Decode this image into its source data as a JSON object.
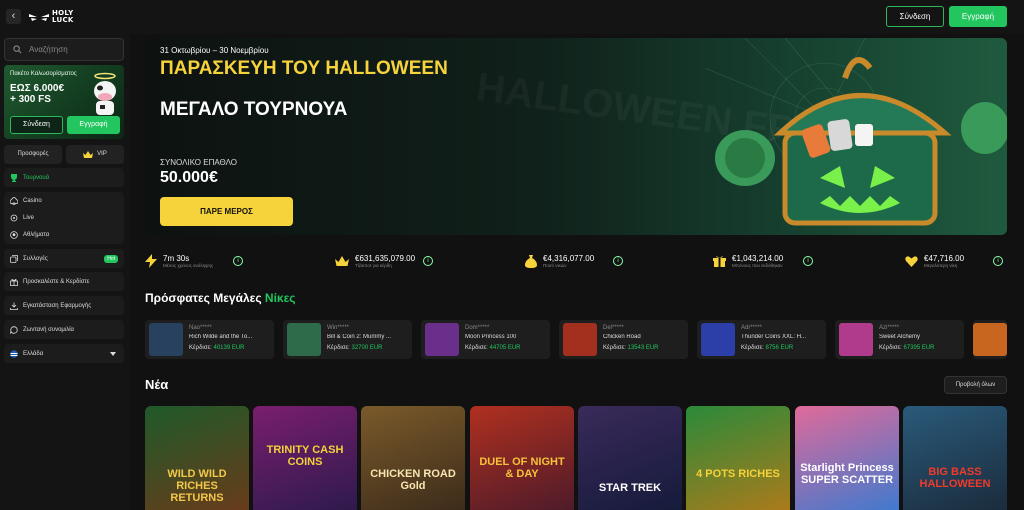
{
  "header": {
    "back_glyph": "‹",
    "logo_line1": "HOLY",
    "logo_line2": "LUCK",
    "login_label": "Σύνδεση",
    "register_label": "Εγγραφή"
  },
  "sidebar": {
    "search_placeholder": "Αναζήτηση",
    "promo": {
      "title": "Πακέτο Καλωσορίσματος",
      "amount_line1": "ΕΩΣ 6.000€",
      "amount_line2": "+ 300 FS",
      "login_label": "Σύνδεση",
      "register_label": "Εγγραφή"
    },
    "offers_label": "Προσφορές",
    "vip_label": "VIP",
    "tournaments_label": "Τουρνουά",
    "group": [
      {
        "label": "Casino",
        "icon": "spade-icon"
      },
      {
        "label": "Live",
        "icon": "live-icon"
      },
      {
        "label": "Αθλήματα",
        "icon": "ball-icon"
      }
    ],
    "collections_label": "Συλλογές",
    "hot_badge": "Hot",
    "invite_label": "Προσκαλέστε & Κερδίστε",
    "install_label": "Εγκατάσταση Εφαρμογής",
    "chat_label": "Ζωντανή συνομιλία",
    "language_label": "Ελλάδα"
  },
  "hero": {
    "date": "31 Οκτωβρίου – 30 Νοεμβρίου",
    "title": "ΠΑΡΑΣΚΕΥΗ ΤΟΥ HALLOWEEN",
    "subtitle": "ΜΕΓΑΛΟ ΤΟΥΡΝΟΥΑ",
    "prize_label": "ΣΥΝΟΛΙΚΟ ΕΠΑΘΛΟ",
    "prize_value": "50.000€",
    "cta_label": "ΠΑΡΕ ΜΕΡΟΣ",
    "watermark": "HALLOWEEN FRI"
  },
  "stats": [
    {
      "value": "7m 30s",
      "label": "Μέσος χρόνος ανάληψης",
      "icon": "lightning-icon"
    },
    {
      "value": "€631,635,079.00",
      "label": "Τζάκποτ για κέρδη",
      "icon": "crown-icon"
    },
    {
      "value": "€4,316,077.00",
      "label": "Ποσό νικών",
      "icon": "moneybag-icon"
    },
    {
      "value": "€1,043,214.00",
      "label": "Μπόνους που εκδόθηκαν",
      "icon": "gift-icon"
    },
    {
      "value": "€47,716.00",
      "label": "Μεγαλύτερη νίκη",
      "icon": "sparkle-heart-icon"
    }
  ],
  "big_wins": {
    "title_part1": "Πρόσφατες Μεγάλες",
    "title_part2": "Νίκες",
    "win_label": "Κέρδισε:",
    "items": [
      {
        "user": "Nao*****",
        "game": "Rich Wilde and the To...",
        "amount": "40139 EUR",
        "color": "#27415e"
      },
      {
        "user": "Win*****",
        "game": "Bill & Coin 2: Mummy ...",
        "amount": "32700 EUR",
        "color": "#2e6b4a"
      },
      {
        "user": "Dom*****",
        "game": "Moon Princess 100",
        "amount": "44705 EUR",
        "color": "#6a2f8a"
      },
      {
        "user": "Del*****",
        "game": "Chicken Road",
        "amount": "13543 EUR",
        "color": "#a3301f"
      },
      {
        "user": "Adr*****",
        "game": "Thunder Coins XXL: H...",
        "amount": "8756 EUR",
        "color": "#2c3fa8"
      },
      {
        "user": "Azi*****",
        "game": "Sweet Alchemy",
        "amount": "67395 EUR",
        "color": "#b03a8c"
      }
    ]
  },
  "new_section": {
    "title": "Νέα",
    "see_all_label": "Προβολή όλων",
    "games": [
      {
        "name": "WILD WILD RICHES RETURNS",
        "bg1": "#1f5a2a",
        "bg2": "#6b3a1a",
        "text_color": "#f2c84b"
      },
      {
        "name": "TRINITY CASH COINS",
        "bg1": "#7a1e6e",
        "bg2": "#2a1a4a",
        "text_color": "#f2d23a"
      },
      {
        "name": "CHICKEN ROAD Gold",
        "bg1": "#7a5a2a",
        "bg2": "#3a2a1a",
        "text_color": "#f6e6b0"
      },
      {
        "name": "DUEL OF NIGHT & DAY",
        "bg1": "#b0301f",
        "bg2": "#4a1a2a",
        "text_color": "#f6c23a"
      },
      {
        "name": "STAR TREK",
        "bg1": "#3a2a5a",
        "bg2": "#141a3a",
        "text_color": "#ffffff"
      },
      {
        "name": "4 POTS RICHES",
        "bg1": "#2a8a3a",
        "bg2": "#b07a1a",
        "text_color": "#f6d23a"
      },
      {
        "name": "Starlight Princess SUPER SCATTER",
        "bg1": "#e06a9a",
        "bg2": "#3a7ad0",
        "text_color": "#ffffff"
      },
      {
        "name": "BIG BASS HALLOWEEN",
        "bg1": "#2a5a7a",
        "bg2": "#1a2a3a",
        "text_color": "#f23a2a"
      }
    ]
  },
  "colors": {
    "accent_green": "#22c55e",
    "accent_yellow": "#f6d33a",
    "background": "#111111"
  }
}
